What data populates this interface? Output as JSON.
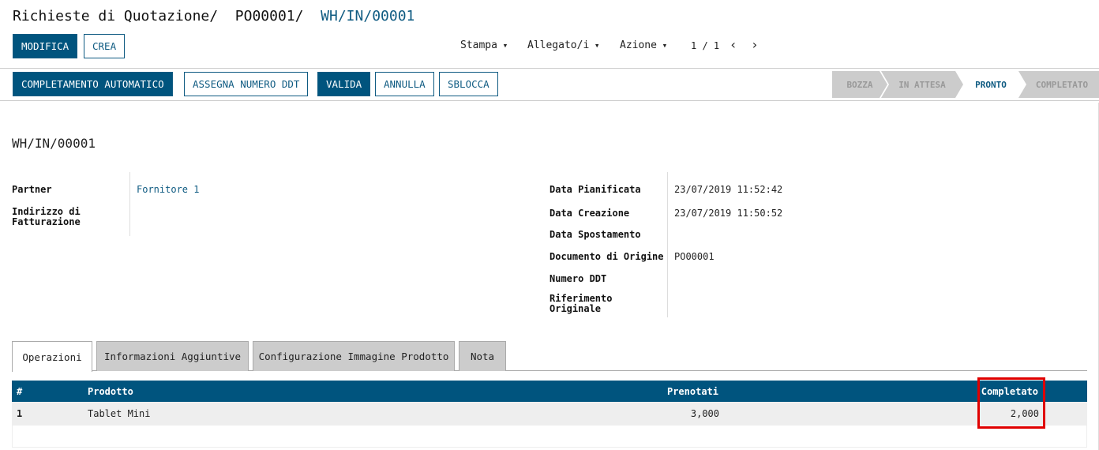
{
  "breadcrumb": {
    "items": [
      "Richieste di Quotazione",
      "PO00001"
    ],
    "current": "WH/IN/00001",
    "sep": "/"
  },
  "toolbar": {
    "edit": "MODIFICA",
    "create": "CREA",
    "print": "Stampa",
    "attachments": "Allegato/i",
    "action": "Azione",
    "pager": "1 / 1"
  },
  "actions": {
    "auto_complete": "COMPLETAMENTO AUTOMATICO",
    "assign_ddt": "ASSEGNA NUMERO DDT",
    "validate": "VALIDA",
    "cancel": "ANNULLA",
    "unlock": "SBLOCCA"
  },
  "statusbar": [
    "BOZZA",
    "IN ATTESA",
    "PRONTO",
    "COMPLETATO"
  ],
  "statusbar_active": "PRONTO",
  "record": {
    "name": "WH/IN/00001",
    "left": {
      "partner_label": "Partner",
      "partner": "Fornitore 1",
      "invoice_label": "Indirizzo di Fatturazione"
    },
    "right": {
      "scheduled_label": "Data Pianificata",
      "scheduled": "23/07/2019 11:52:42",
      "created_label": "Data Creazione",
      "created": "23/07/2019 11:50:52",
      "moved_label": "Data Spostamento",
      "origin_label": "Documento di Origine",
      "origin": "PO00001",
      "ddt_label": "Numero DDT",
      "ref_label": "Riferimento Originale"
    }
  },
  "tabs": [
    "Operazioni",
    "Informazioni Aggiuntive",
    "Configurazione Immagine Prodotto",
    "Nota"
  ],
  "table": {
    "headers": [
      "#",
      "Prodotto",
      "Prenotati",
      "Completato"
    ],
    "rows": [
      [
        "1",
        "Tablet Mini",
        "3,000",
        "2,000"
      ]
    ]
  },
  "colors": {
    "primary": "#00547e",
    "highlight": "#e00000"
  }
}
